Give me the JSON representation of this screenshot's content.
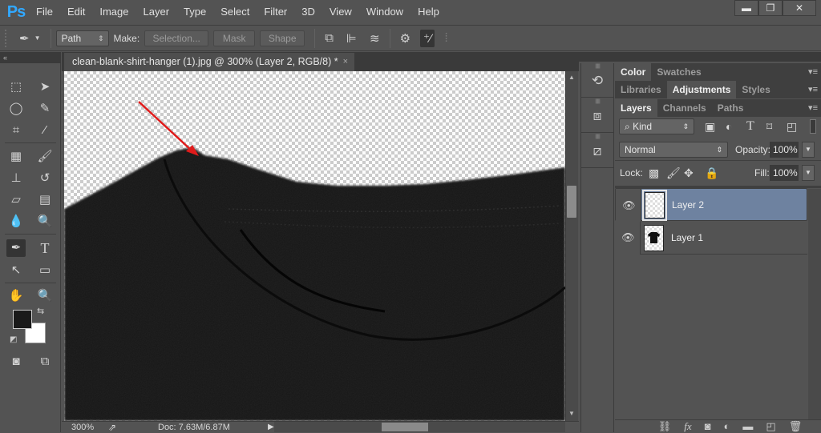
{
  "app": {
    "logo": "Ps"
  },
  "menu": [
    "File",
    "Edit",
    "Image",
    "Layer",
    "Type",
    "Select",
    "Filter",
    "3D",
    "View",
    "Window",
    "Help"
  ],
  "window_controls": {
    "minimize": "▬",
    "restore": "❐",
    "close": "✕"
  },
  "options_bar": {
    "tool_mode": "Path",
    "make_label": "Make:",
    "selection_button": "Selection...",
    "mask_button": "Mask",
    "shape_button": "Shape"
  },
  "document": {
    "tab_title": "clean-blank-shirt-hanger (1).jpg @ 300% (Layer 2, RGB/8) *",
    "close": "×"
  },
  "status": {
    "zoom": "300%",
    "doc_info": "Doc: 7.63M/6.87M"
  },
  "panels": {
    "color_group": {
      "tabs": [
        "Color",
        "Swatches"
      ],
      "active": "Color"
    },
    "adjust_group": {
      "tabs": [
        "Libraries",
        "Adjustments",
        "Styles"
      ],
      "active": "Adjustments"
    },
    "layers_group": {
      "tabs": [
        "Layers",
        "Channels",
        "Paths"
      ],
      "active": "Layers"
    },
    "filter_kind": "Kind",
    "blend_mode": "Normal",
    "opacity_label": "Opacity:",
    "opacity_value": "100%",
    "lock_label": "Lock:",
    "fill_label": "Fill:",
    "fill_value": "100%",
    "layers": [
      {
        "name": "Layer 2",
        "selected": true,
        "visible": true
      },
      {
        "name": "Layer 1",
        "selected": false,
        "visible": true
      }
    ]
  },
  "colors": {
    "foreground": "#1a1a1a",
    "background": "#ffffff",
    "selection": "#6e82a0",
    "annotation_arrow": "#e01b1b"
  }
}
